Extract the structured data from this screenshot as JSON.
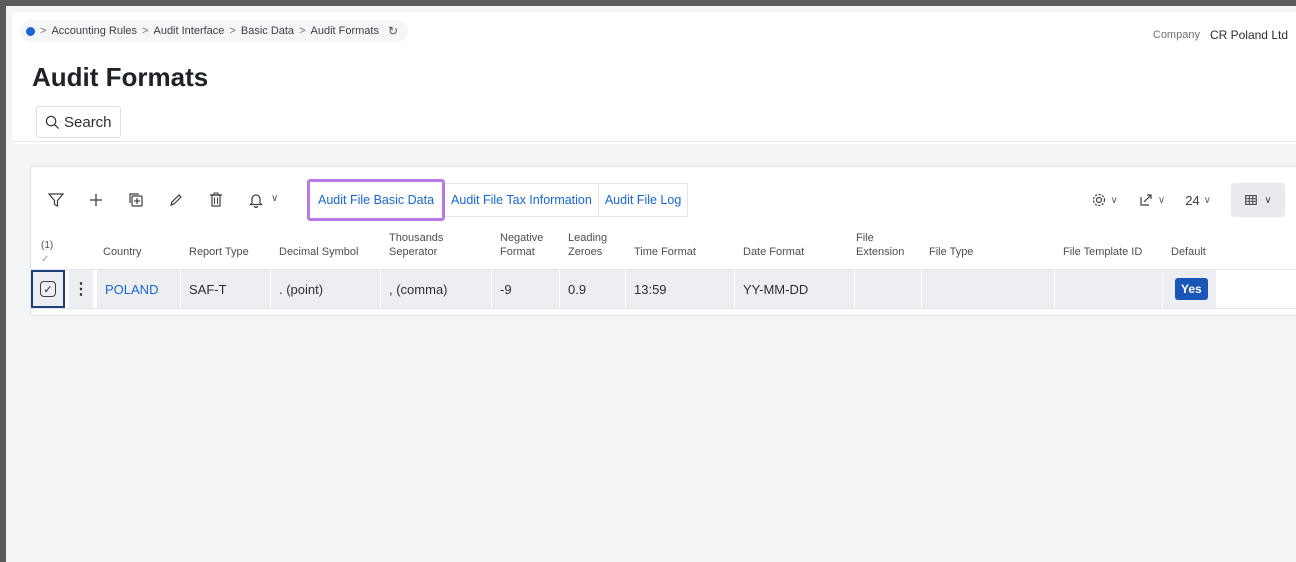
{
  "breadcrumb": {
    "items": [
      "Accounting Rules",
      "Audit Interface",
      "Basic Data",
      "Audit Formats"
    ]
  },
  "company": {
    "label": "Company",
    "value": "CR Poland Ltd"
  },
  "page": {
    "title": "Audit Formats"
  },
  "search": {
    "label": "Search"
  },
  "tabs": [
    {
      "label": "Audit File Basic Data",
      "highlighted": true
    },
    {
      "label": "Audit File Tax Information",
      "highlighted": false
    },
    {
      "label": "Audit File Log",
      "highlighted": false
    }
  ],
  "page_size": "24",
  "grid": {
    "selected_count": "(1)",
    "columns": {
      "country": "Country",
      "report_type": "Report Type",
      "decimal_symbol": "Decimal Symbol",
      "thousands_line1": "Thousands",
      "thousands_line2": "Seperator",
      "negative_line1": "Negative",
      "negative_line2": "Format",
      "leading_line1": "Leading",
      "leading_line2": "Zeroes",
      "time_format": "Time Format",
      "date_format": "Date Format",
      "file_ext_line1": "File",
      "file_ext_line2": "Extension",
      "file_type": "File Type",
      "file_template_id": "File Template ID",
      "default": "Default"
    },
    "row": {
      "country": "POLAND",
      "report_type": "SAF-T",
      "decimal_symbol": ". (point)",
      "thousands_separator": ", (comma)",
      "negative_format": "-9",
      "leading_zeroes": "0.9",
      "time_format": "13:59",
      "date_format": "YY-MM-DD",
      "file_extension": "",
      "file_type": "",
      "file_template_id": "",
      "default": "Yes"
    }
  },
  "colors": {
    "accent": "#1a66d2",
    "highlight": "#b77be8",
    "badge": "#1a56b8"
  }
}
